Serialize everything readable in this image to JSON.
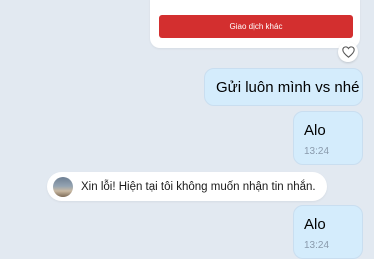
{
  "card": {
    "button_label": "Giao dịch khác"
  },
  "messages": [
    {
      "text": "Gửi luôn mình vs nhé"
    },
    {
      "text": "Alo",
      "time": "13:24"
    },
    {
      "text": "Alo",
      "time": "13:24"
    }
  ],
  "system_notice": {
    "text": "Xin lỗi! Hiện tại tôi không muốn nhận tin nhắn."
  },
  "colors": {
    "accent_red": "#d32f2f",
    "sent_bubble": "#d4ecfc",
    "chat_background": "#e2e9f1"
  }
}
